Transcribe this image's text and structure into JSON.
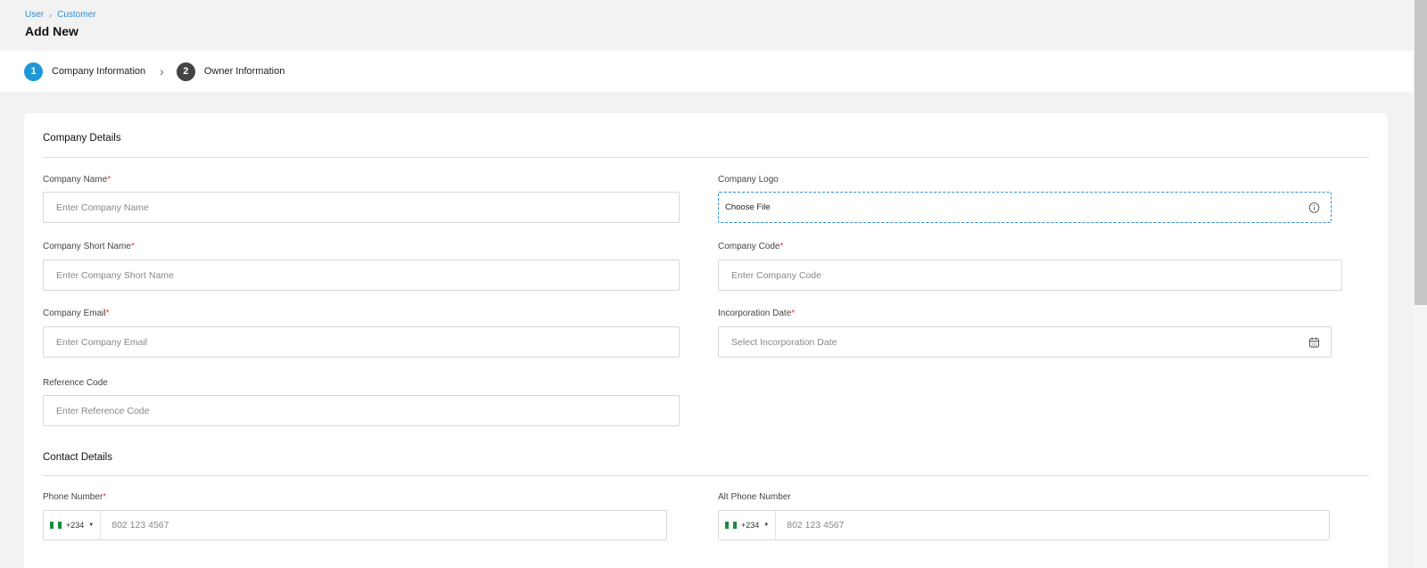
{
  "breadcrumb": {
    "items": [
      "User",
      "Customer"
    ]
  },
  "page": {
    "title": "Add New"
  },
  "stepper": {
    "steps": [
      {
        "number": "1",
        "label": "Company Information"
      },
      {
        "number": "2",
        "label": "Owner Information"
      }
    ]
  },
  "company_details": {
    "title": "Company Details",
    "company_name": {
      "label": "Company Name",
      "placeholder": "Enter Company Name"
    },
    "company_logo": {
      "label": "Company Logo",
      "button": "Choose File"
    },
    "company_short_name": {
      "label": "Company Short Name",
      "placeholder": "Enter Company Short Name"
    },
    "company_code": {
      "label": "Company Code",
      "placeholder": "Enter Company Code"
    },
    "company_email": {
      "label": "Company Email",
      "placeholder": "Enter Company Email"
    },
    "incorporation_date": {
      "label": "Incorporation Date",
      "placeholder": "Select Incorporation Date"
    },
    "reference_code": {
      "label": "Reference Code",
      "placeholder": "Enter Reference Code"
    }
  },
  "contact_details": {
    "title": "Contact Details",
    "phone_number": {
      "label": "Phone Number",
      "dial_code": "+234",
      "placeholder": "802 123 4567"
    },
    "alt_phone_number": {
      "label": "Alt Phone Number",
      "dial_code": "+234",
      "placeholder": "802 123 4567"
    }
  },
  "required_marker": "*",
  "colors": {
    "accent": "#1f98d8",
    "required": "#e53935",
    "flag_green": "#1a8a3e"
  },
  "icons": {
    "breadcrumb_sep": "chevron-right-icon",
    "step_sep": "chevron-right-icon",
    "logo_info": "info-icon",
    "date": "calendar-icon",
    "dropdown": "caret-down-icon",
    "flag": "nigeria-flag-icon"
  }
}
